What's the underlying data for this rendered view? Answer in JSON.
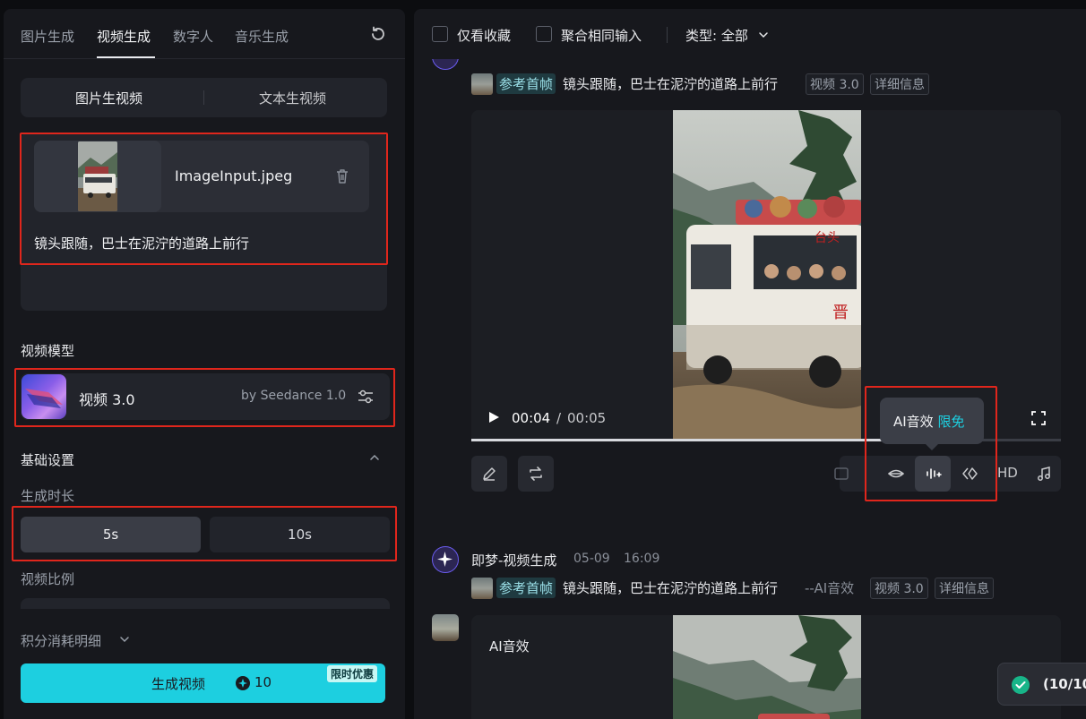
{
  "left_panel": {
    "tabs": [
      {
        "label": "图片生成"
      },
      {
        "label": "视频生成"
      },
      {
        "label": "数字人"
      },
      {
        "label": "音乐生成"
      }
    ],
    "mode_segments": [
      "图片生视频",
      "文本生视频"
    ],
    "upload": {
      "file_name": "ImageInput.jpeg"
    },
    "prompt": "镜头跟随，巴士在泥泞的道路上前行",
    "model_section": {
      "title": "视频模型",
      "model_name": "视频 3.0",
      "model_by": "by Seedance 1.0"
    },
    "basic_settings": {
      "title": "基础设置",
      "duration_label": "生成时长",
      "durations": [
        "5s",
        "10s"
      ],
      "selected_duration": "5s",
      "ratio_label": "视频比例"
    },
    "cost_detail": "积分消耗明细",
    "generate": {
      "label": "生成视频",
      "cost": "10",
      "badge": "限时优惠"
    }
  },
  "right_panel": {
    "filters": {
      "favorites_only": "仅看收藏",
      "merge_same_input": "聚合相同输入",
      "type_select": "类型: 全部"
    },
    "item1": {
      "ref_label": "参考首帧",
      "prompt": "镜头跟随，巴士在泥泞的道路上前行",
      "model_tag": "视频 3.0",
      "detail_tag": "详细信息",
      "player": {
        "current_time": "00:04",
        "separator": "/",
        "total_time": "00:05",
        "progress": 0.8
      },
      "frame_text": {
        "sign_top": "台头",
        "sign_side": "晋"
      },
      "toolbar": {
        "hd": "HD"
      },
      "tooltip": {
        "text": "AI音效",
        "highlight": "限免"
      }
    },
    "item2": {
      "title": "即梦-视频生成",
      "date": "05-09",
      "time": "16:09",
      "ref_label": "参考首帧",
      "prompt": "镜头跟随，巴士在泥泞的道路上前行",
      "suffix": "--AI音效",
      "model_tag": "视频 3.0",
      "detail_tag": "详细信息",
      "card_label": "AI音效"
    },
    "toast": {
      "text": "(10/10"
    }
  }
}
